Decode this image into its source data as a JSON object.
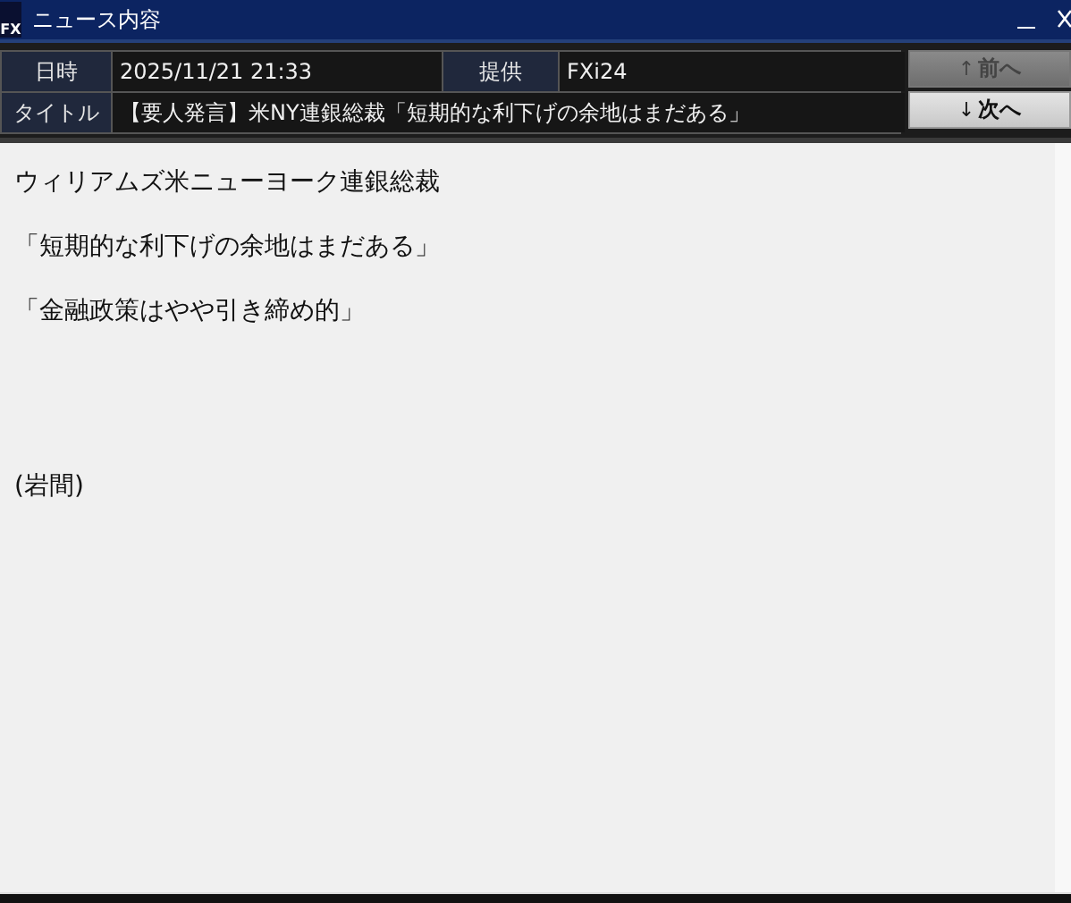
{
  "window": {
    "title": "ニュース内容",
    "logo": "FX"
  },
  "header": {
    "date_label": "日時",
    "date": "2025/11/21 21:33",
    "source_label": "提供",
    "source": "FXi24",
    "title_label": "タイトル",
    "title": "【要人発言】米NY連銀総裁「短期的な利下げの余地はまだある」"
  },
  "nav_buttons": [
    {
      "arrow": "↑",
      "label": "前へ",
      "disabled": true
    },
    {
      "arrow": "↓",
      "label": "次へ",
      "disabled": false
    }
  ],
  "body": [
    {
      "kind": "text",
      "text": "ウィリアムズ米ニューヨーク連銀総裁"
    },
    {
      "kind": "text",
      "text": "「短期的な利下げの余地はまだある」"
    },
    {
      "kind": "text",
      "text": "「金融政策はやや引き締め的」"
    },
    {
      "kind": "credit",
      "text": "(岩間)"
    }
  ]
}
